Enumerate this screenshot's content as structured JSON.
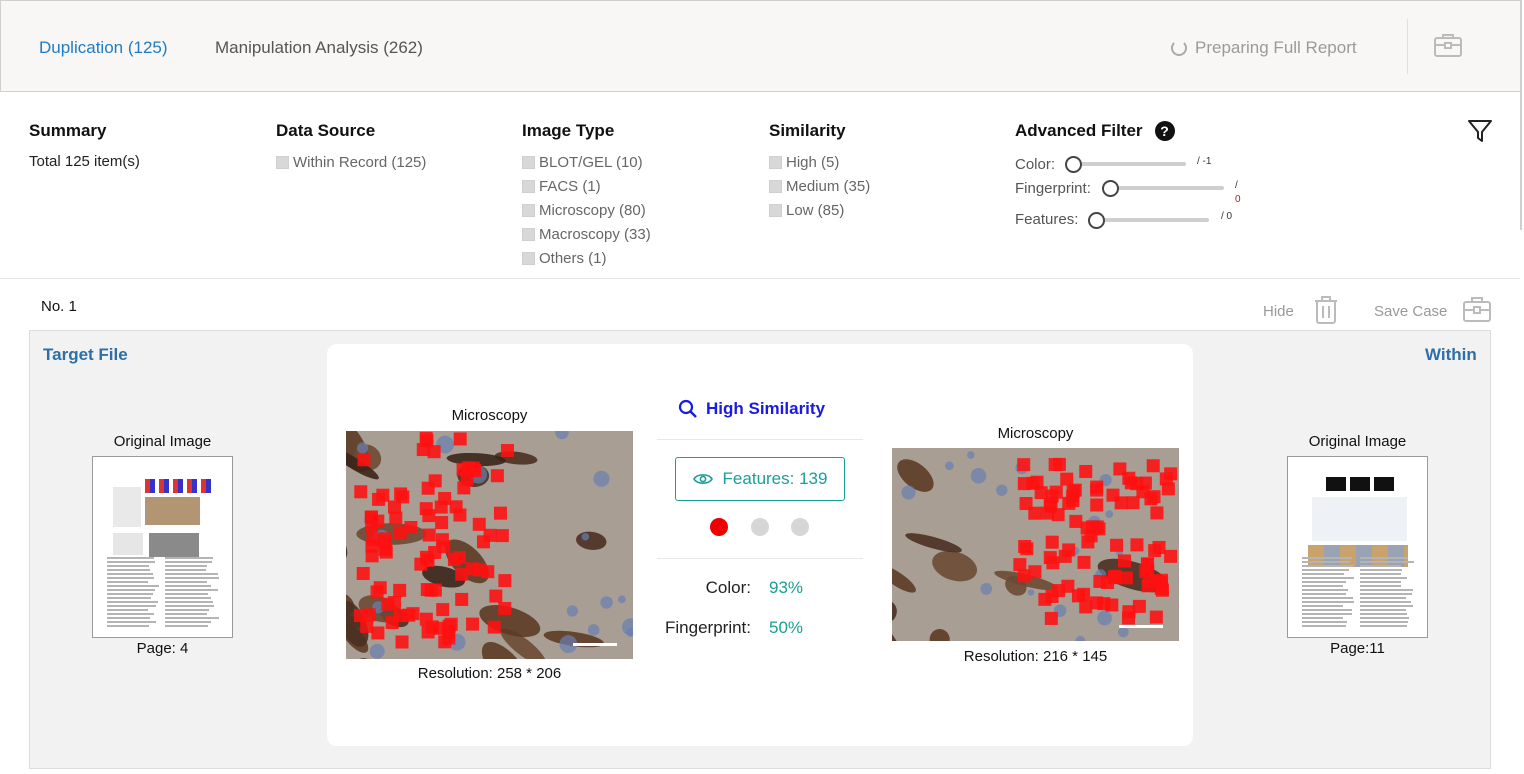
{
  "tabs": [
    {
      "label": "Duplication (125)",
      "active": true
    },
    {
      "label": "Manipulation Analysis (262)",
      "active": false
    }
  ],
  "header": {
    "report_status": "Preparing Full Report",
    "report_icon": "spinner-icon",
    "briefcase_icon": "briefcase-icon"
  },
  "filters": {
    "summary": {
      "title": "Summary",
      "text": "Total 125 item(s)"
    },
    "data_source": {
      "title": "Data Source",
      "items": [
        "Within Record (125)"
      ]
    },
    "image_type": {
      "title": "Image Type",
      "items": [
        "BLOT/GEL (10)",
        "FACS (1)",
        "Microscopy (80)",
        "Macroscopy (33)",
        "Others (1)"
      ]
    },
    "similarity": {
      "title": "Similarity",
      "items": [
        "High (5)",
        "Medium (35)",
        "Low (85)"
      ]
    },
    "advanced": {
      "title": "Advanced Filter",
      "help_icon": "?",
      "sliders": [
        {
          "label": "Color:",
          "value": "/ -1",
          "level": 0
        },
        {
          "label": "Fingerprint:",
          "value": "/",
          "value2": "0",
          "level": 0
        },
        {
          "label": "Features:",
          "value": "/ 0",
          "level": 0
        }
      ]
    },
    "filter_icon": "funnel-icon"
  },
  "result": {
    "number": "No. 1",
    "hide_label": "Hide",
    "save_label": "Save Case",
    "left_title": "Target File",
    "right_title": "Within",
    "left": {
      "original_label": "Original Image",
      "page": "Page: 4",
      "type": "Microscopy",
      "resolution": "Resolution: 258 * 206"
    },
    "right": {
      "original_label": "Original Image",
      "page": "Page:11",
      "type": "Microscopy",
      "resolution": "Resolution: 216 * 145"
    },
    "similarity_label": "High Similarity",
    "features_label": "Features: 139",
    "metrics": [
      {
        "label": "Color:",
        "value": "93%"
      },
      {
        "label": "Fingerprint:",
        "value": "50%"
      }
    ],
    "pager": {
      "count": 3,
      "active": 0
    },
    "accent_red": "#ee0000",
    "accent_teal": "#1a9e96"
  }
}
